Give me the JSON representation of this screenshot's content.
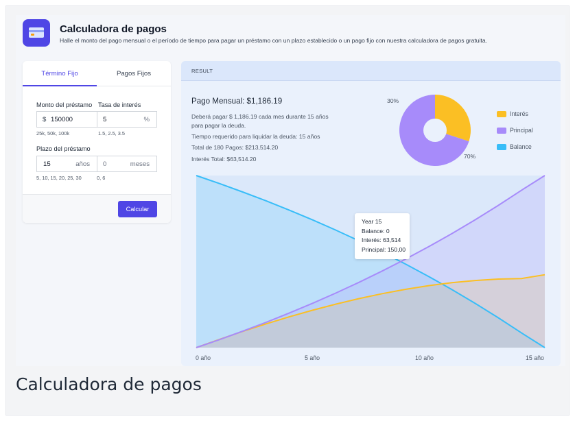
{
  "header": {
    "title": "Calculadora de pagos",
    "subtitle": "Halle el monto del pago mensual o el período de tiempo para pagar un préstamo con un plazo establecido o un pago fijo con nuestra calculadora de pagos gratuita."
  },
  "tabs": [
    {
      "label": "Término Fijo",
      "active": true
    },
    {
      "label": "Pagos Fijos",
      "active": false
    }
  ],
  "form": {
    "loan_amount": {
      "label": "Monto del préstamo",
      "prefix": "$",
      "value": "150000",
      "hint": "25k, 50k, 100k"
    },
    "interest_rate": {
      "label": "Tasa de interés",
      "value": "5",
      "suffix": "%",
      "hint": "1.5, 2.5, 3.5"
    },
    "term_label": "Plazo del préstamo",
    "years": {
      "value": "15",
      "suffix": "años",
      "hint": "5, 10, 15, 20, 25, 30"
    },
    "months": {
      "value": "0",
      "suffix": "meses",
      "hint": "0, 6"
    },
    "calculate_label": "Calcular"
  },
  "result": {
    "bar_label": "RESULT",
    "monthly_payment": "Pago Mensual: $1,186.19",
    "line1": "Deberá pagar $ 1,186.19 cada mes durante 15 años",
    "line2": "para pagar la deuda.",
    "line3": "Tiempo requerido para liquidar la deuda: 15 años",
    "line4": "Total de 180 Pagos: $213,514.20",
    "line5": "Interés Total: $63,514.20"
  },
  "colors": {
    "accent": "#4f46e5",
    "interest": "#fbbf24",
    "principal": "#a78bfa",
    "balance": "#38bdf8"
  },
  "chart_data": [
    {
      "type": "pie",
      "slices": [
        {
          "label": "Interés",
          "percent": 30,
          "color": "#fbbf24"
        },
        {
          "label": "Principal",
          "percent": 70,
          "color": "#a78bfa"
        }
      ],
      "labels": [
        "30%",
        "70%"
      ],
      "legend": [
        {
          "label": "Interés",
          "color": "#fbbf24"
        },
        {
          "label": "Principal",
          "color": "#a78bfa"
        },
        {
          "label": "Balance",
          "color": "#38bdf8"
        }
      ],
      "legend_position": "right"
    },
    {
      "type": "area",
      "x": [
        0,
        1,
        2,
        3,
        4,
        5,
        6,
        7,
        8,
        9,
        10,
        11,
        12,
        13,
        14,
        15
      ],
      "x_tick_labels": [
        "0 año",
        "5 año",
        "10 año",
        "15 año"
      ],
      "x_ticks": [
        0,
        5,
        10,
        15
      ],
      "ylim": [
        0,
        150000
      ],
      "series": [
        {
          "name": "Balance",
          "color": "#38bdf8",
          "values": [
            150000,
            143013,
            135680,
            127985,
            119901,
            111408,
            102485,
            93113,
            83268,
            72922,
            62054,
            50631,
            38631,
            26025,
            12779,
            0
          ]
        },
        {
          "name": "Interés",
          "color": "#fbbf24",
          "values": [
            0,
            7247,
            14155,
            20700,
            26856,
            32597,
            37894,
            42716,
            47031,
            50805,
            54001,
            56582,
            58506,
            59734,
            60222,
            63514
          ]
        },
        {
          "name": "Principal",
          "color": "#a78bfa",
          "values": [
            0,
            6987,
            14320,
            22015,
            30099,
            38592,
            47515,
            56887,
            66732,
            77078,
            87946,
            99369,
            111369,
            123975,
            137221,
            150000
          ]
        }
      ],
      "tooltip": {
        "title": "Year 15",
        "balance": "Balance: 0",
        "interest": "Interés: 63,514",
        "principal": "Principal: 150,00"
      }
    }
  ],
  "caption": "Calculadora de pagos"
}
